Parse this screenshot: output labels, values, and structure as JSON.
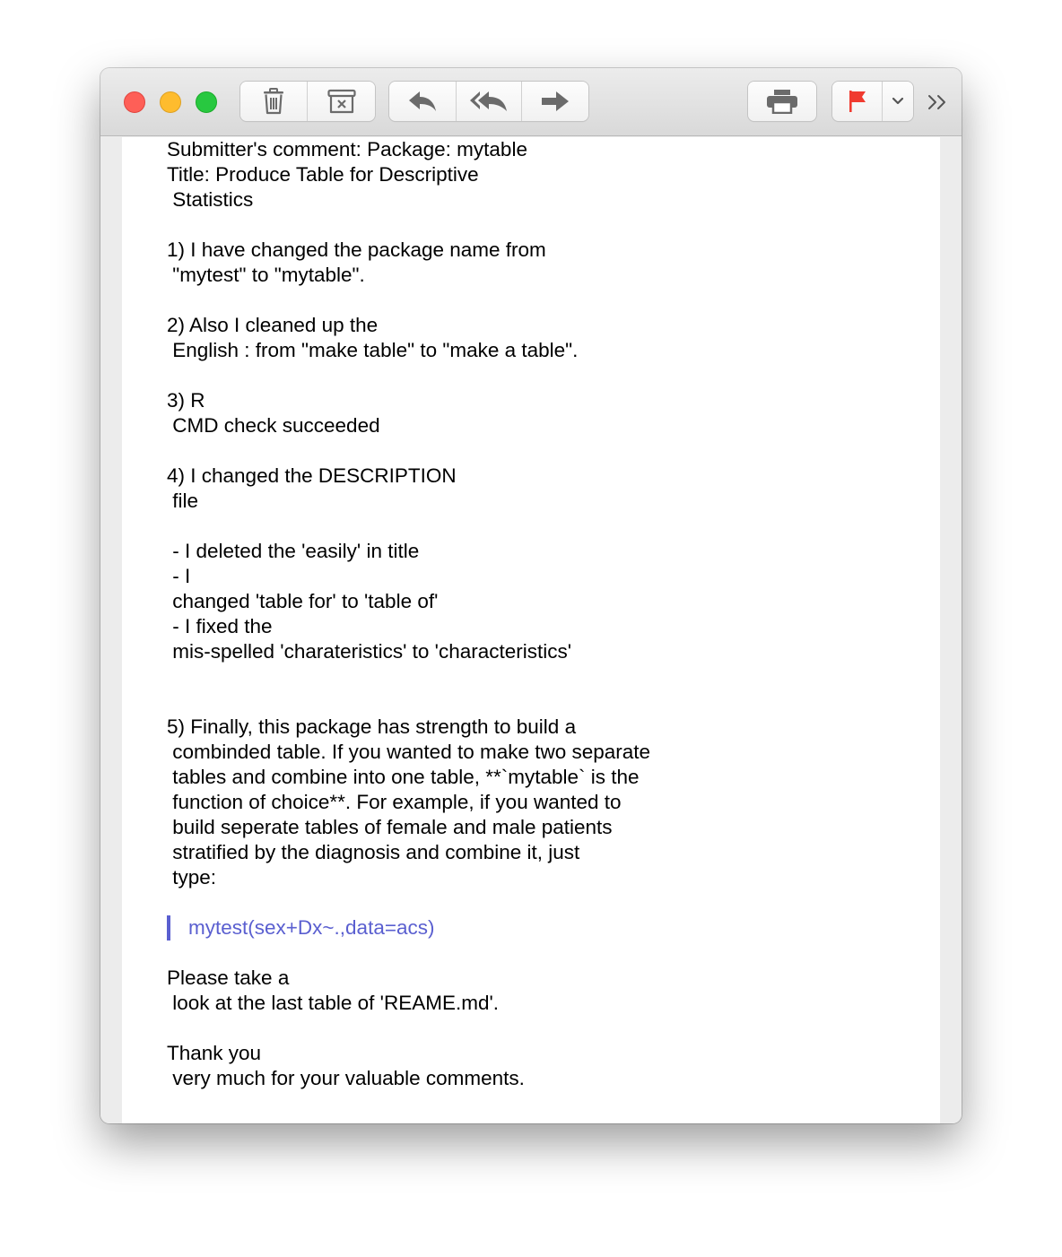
{
  "toolbar": {
    "traffic_lights": {
      "close": "close-window",
      "minimize": "minimize-window",
      "maximize": "maximize-window"
    },
    "delete_icon": "trash-icon",
    "archive_icon": "archive-icon",
    "reply_icon": "reply-icon",
    "reply_all_icon": "reply-all-icon",
    "forward_icon": "forward-icon",
    "print_icon": "printer-icon",
    "flag_icon": "flag-icon",
    "flag_color": "#f03a2f",
    "flag_menu_icon": "chevron-down-icon",
    "overflow_icon": "double-chevron-right-icon"
  },
  "message": {
    "lines": [
      "Submitter's comment: Package: mytable",
      "Title: Produce Table for Descriptive",
      " Statistics",
      "",
      "1) I have changed the package name from",
      " \"mytest\" to \"mytable\".",
      "",
      "2) Also I cleaned up the",
      " English : from \"make table\" to \"make a table\".",
      "",
      "3) R",
      " CMD check succeeded",
      "",
      "4) I changed the DESCRIPTION",
      " file",
      "",
      " - I deleted the 'easily' in title",
      " - I",
      " changed 'table for' to 'table of'",
      " - I fixed the",
      " mis-spelled 'charateristics' to 'characteristics'",
      "",
      "",
      "5) Finally, this package has strength to build a",
      " combinded table. If you wanted to make two separate",
      " tables and combine into one table, **`mytable` is the",
      " function of choice**. For example, if you wanted to",
      " build seperate tables of female and male patients",
      " stratified by the diagnosis and combine it, just",
      " type:",
      ""
    ],
    "quote": "mytest(sex+Dx~.,data=acs)",
    "quote_color": "#5a5fd0",
    "closing_lines": [
      "",
      "Please take a",
      " look at the last table of 'REAME.md'.",
      "",
      "Thank you",
      " very much for your valuable comments."
    ]
  }
}
